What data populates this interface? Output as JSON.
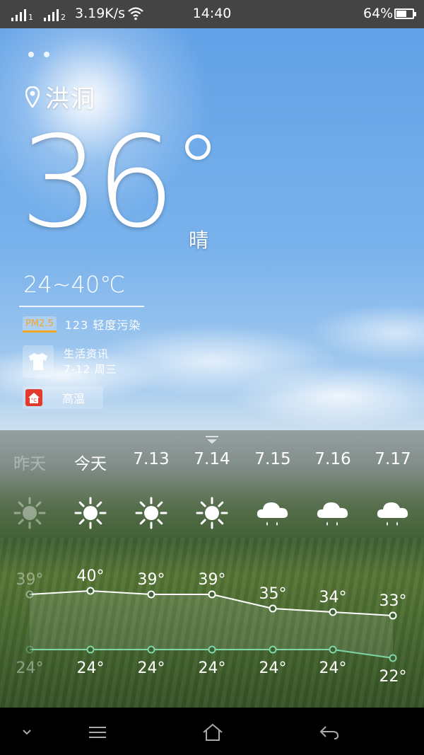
{
  "status_bar": {
    "net_speed": "3.19K/s",
    "time": "14:40",
    "battery_percent": "64%",
    "battery_level": 0.64,
    "sim1_label": "1",
    "sim2_label": "2"
  },
  "weather": {
    "city": "洪洞",
    "temperature": "36",
    "condition": "晴",
    "temp_range": "24~40℃",
    "pm25_badge": "PM2.5",
    "pm25_text": "123 轻度污染",
    "life_info_title": "生活资讯",
    "life_info_date": "7-12 周三",
    "alert_label": "高温"
  },
  "forecast": {
    "days": [
      {
        "label": "昨天",
        "icon": "sun-icon",
        "high": "39°",
        "low": "24°",
        "dim": true
      },
      {
        "label": "今天",
        "icon": "sun-icon",
        "high": "40°",
        "low": "24°",
        "dim": false
      },
      {
        "label": "7.13",
        "icon": "sun-icon",
        "high": "39°",
        "low": "24°",
        "dim": false
      },
      {
        "label": "7.14",
        "icon": "sun-icon",
        "high": "39°",
        "low": "24°",
        "dim": false
      },
      {
        "label": "7.15",
        "icon": "rain-cloud-icon",
        "high": "35°",
        "low": "24°",
        "dim": false
      },
      {
        "label": "7.16",
        "icon": "rain-cloud-icon",
        "high": "34°",
        "low": "24°",
        "dim": false
      },
      {
        "label": "7.17",
        "icon": "rain-cloud-icon",
        "high": "33°",
        "low": "22°",
        "dim": false
      }
    ]
  },
  "chart_data": {
    "type": "line",
    "categories": [
      "昨天",
      "今天",
      "7.13",
      "7.14",
      "7.15",
      "7.16",
      "7.17"
    ],
    "series": [
      {
        "values": [
          39,
          40,
          39,
          39,
          35,
          34,
          33
        ]
      },
      {
        "values": [
          24,
          24,
          24,
          24,
          24,
          24,
          22
        ]
      }
    ],
    "colors": {
      "high": "#ffffff",
      "low": "#7fd6a6"
    }
  }
}
